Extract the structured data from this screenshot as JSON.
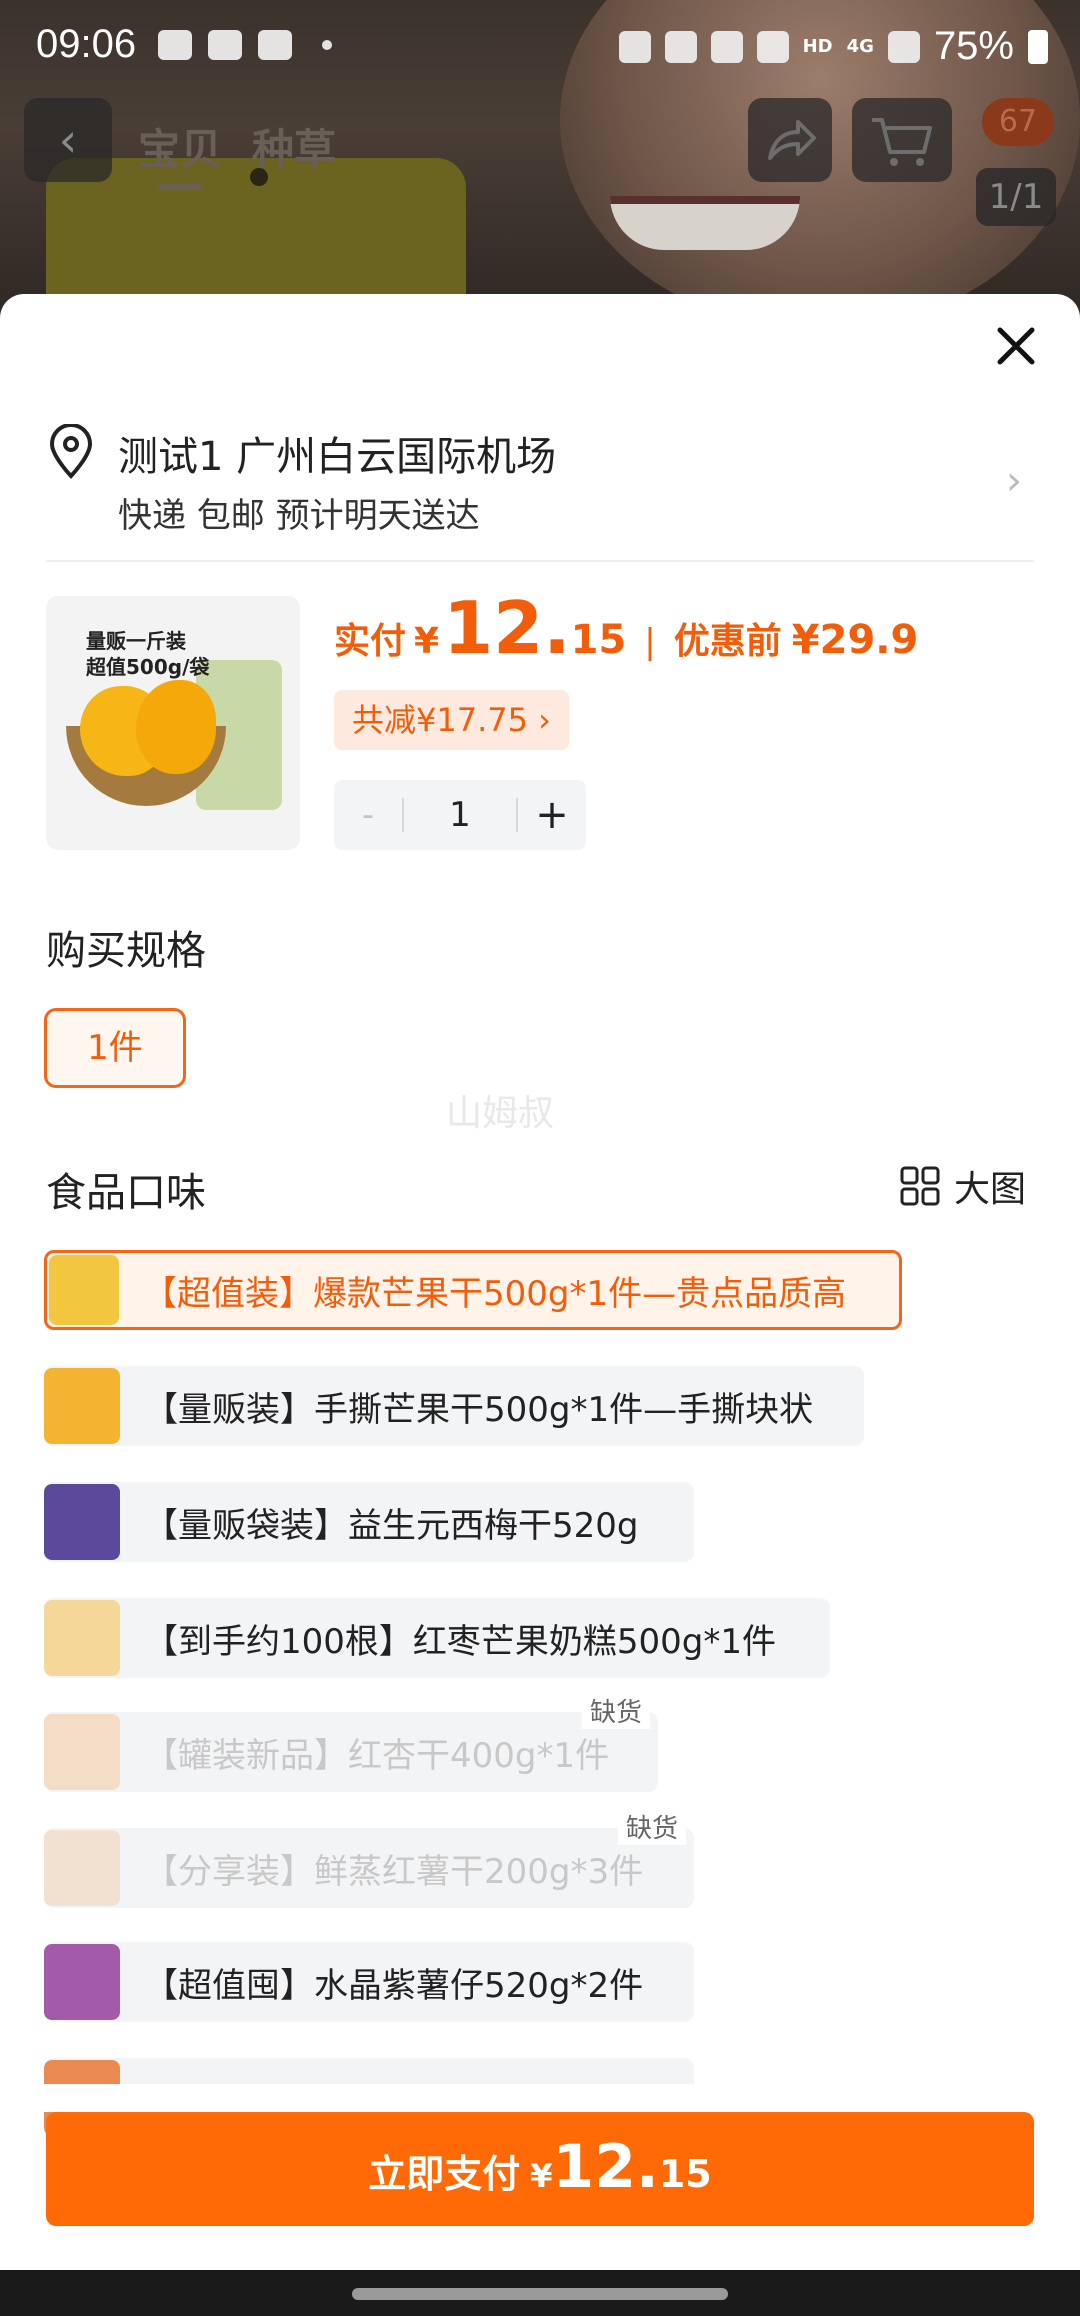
{
  "status_bar": {
    "time": "09:06",
    "network": "4G",
    "hd": "HD",
    "battery": "75%"
  },
  "background_page": {
    "back_icon": "chevron-left-icon",
    "tabs": [
      "宝贝",
      "种草"
    ],
    "cart_badge": "67",
    "page_indicator": "1/1"
  },
  "sheet": {
    "address": {
      "line1": "测试1 广州白云国际机场",
      "line2": "快递 包邮 预计明天送达"
    },
    "price": {
      "label": "实付",
      "yen": "¥",
      "integer": "12.",
      "decimal": "15",
      "separator": "|",
      "before_label": "优惠前",
      "before_value": "¥29.9"
    },
    "discount_chip": "共减¥17.75 ›",
    "product_image_text": "量贩一斤装\n超值500g/袋",
    "quantity": {
      "minus": "-",
      "value": "1",
      "plus": "+"
    },
    "spec_title": "购买规格",
    "spec_option": "1件",
    "watermark": "山姆叔",
    "flavor_title": "食品口味",
    "big_view": "大图",
    "flavors": [
      {
        "label": "【超值装】爆款芒果干500g*1件—贵点品质高",
        "state": "selected",
        "thumb_color": "#f3c640"
      },
      {
        "label": "【量贩装】手撕芒果干500g*1件—手撕块状",
        "state": "normal",
        "thumb_color": "#f2b431"
      },
      {
        "label": "【量贩袋装】益生元西梅干520g",
        "state": "normal",
        "thumb_color": "#5b4a9c"
      },
      {
        "label": "【到手约100根】红枣芒果奶糕500g*1件",
        "state": "normal",
        "thumb_color": "#f6d79a"
      },
      {
        "label": "【罐装新品】红杏干400g*1件",
        "state": "disabled",
        "tag": "缺货",
        "thumb_color": "#f6c28c"
      },
      {
        "label": "【分享装】鲜蒸红薯干200g*3件",
        "state": "disabled",
        "tag": "缺货",
        "thumb_color": "#f1c9a4"
      },
      {
        "label": "【超值囤】水晶紫薯仔520g*2件",
        "state": "normal",
        "thumb_color": "#a25aa9"
      }
    ],
    "pay_button": {
      "label": "立即支付",
      "yen": "¥",
      "integer": "12.",
      "decimal": "15"
    }
  },
  "colors": {
    "accent": "#ff6a06",
    "price": "#f25d0a",
    "chip_bg": "#fde9dd"
  }
}
